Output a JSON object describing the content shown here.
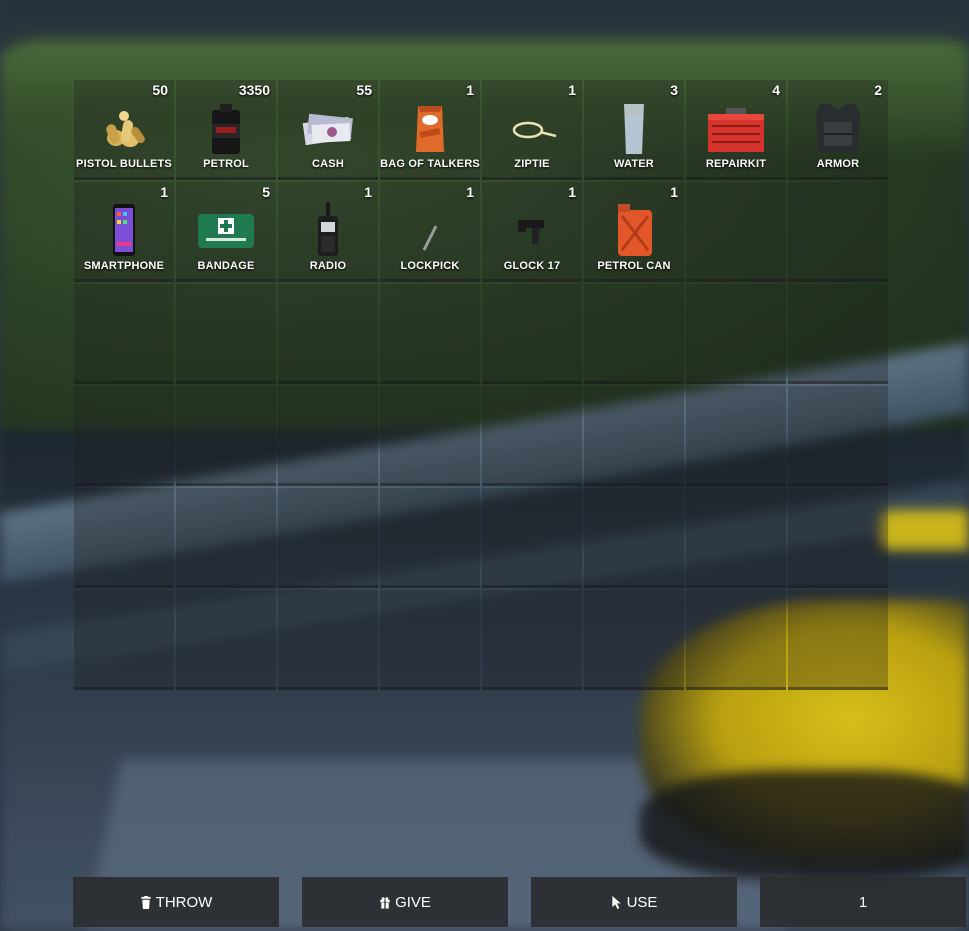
{
  "inventory": {
    "slots": [
      {
        "name": "PISTOL BULLETS",
        "count": "50",
        "icon": "pistol-bullets-icon"
      },
      {
        "name": "PETROL",
        "count": "3350",
        "icon": "petrol-canister-icon"
      },
      {
        "name": "CASH",
        "count": "55",
        "icon": "cash-icon"
      },
      {
        "name": "BAG OF TALKERS",
        "count": "1",
        "icon": "crisps-bag-icon"
      },
      {
        "name": "ZIPTIE",
        "count": "1",
        "icon": "ziptie-icon"
      },
      {
        "name": "WATER",
        "count": "3",
        "icon": "water-glass-icon"
      },
      {
        "name": "REPAIRKIT",
        "count": "4",
        "icon": "toolbox-icon"
      },
      {
        "name": "ARMOR",
        "count": "2",
        "icon": "body-armor-icon"
      },
      {
        "name": "SMARTPHONE",
        "count": "1",
        "icon": "smartphone-icon"
      },
      {
        "name": "BANDAGE",
        "count": "5",
        "icon": "first-aid-kit-icon"
      },
      {
        "name": "RADIO",
        "count": "1",
        "icon": "radio-icon"
      },
      {
        "name": "LOCKPICK",
        "count": "1",
        "icon": "lockpick-icon"
      },
      {
        "name": "GLOCK 17",
        "count": "1",
        "icon": "pistol-icon"
      },
      {
        "name": "PETROL CAN",
        "count": "1",
        "icon": "jerry-can-icon"
      }
    ]
  },
  "actions": {
    "throw_label": "THROW",
    "throw_icon": "trash-icon",
    "give_label": "GIVE",
    "give_icon": "gift-icon",
    "use_label": "USE",
    "use_icon": "cursor-icon",
    "amount_value": "1"
  },
  "colors": {
    "slot_bg": "#1e1e1e",
    "button_bg": "#2a2c30",
    "text": "#ffffff"
  }
}
